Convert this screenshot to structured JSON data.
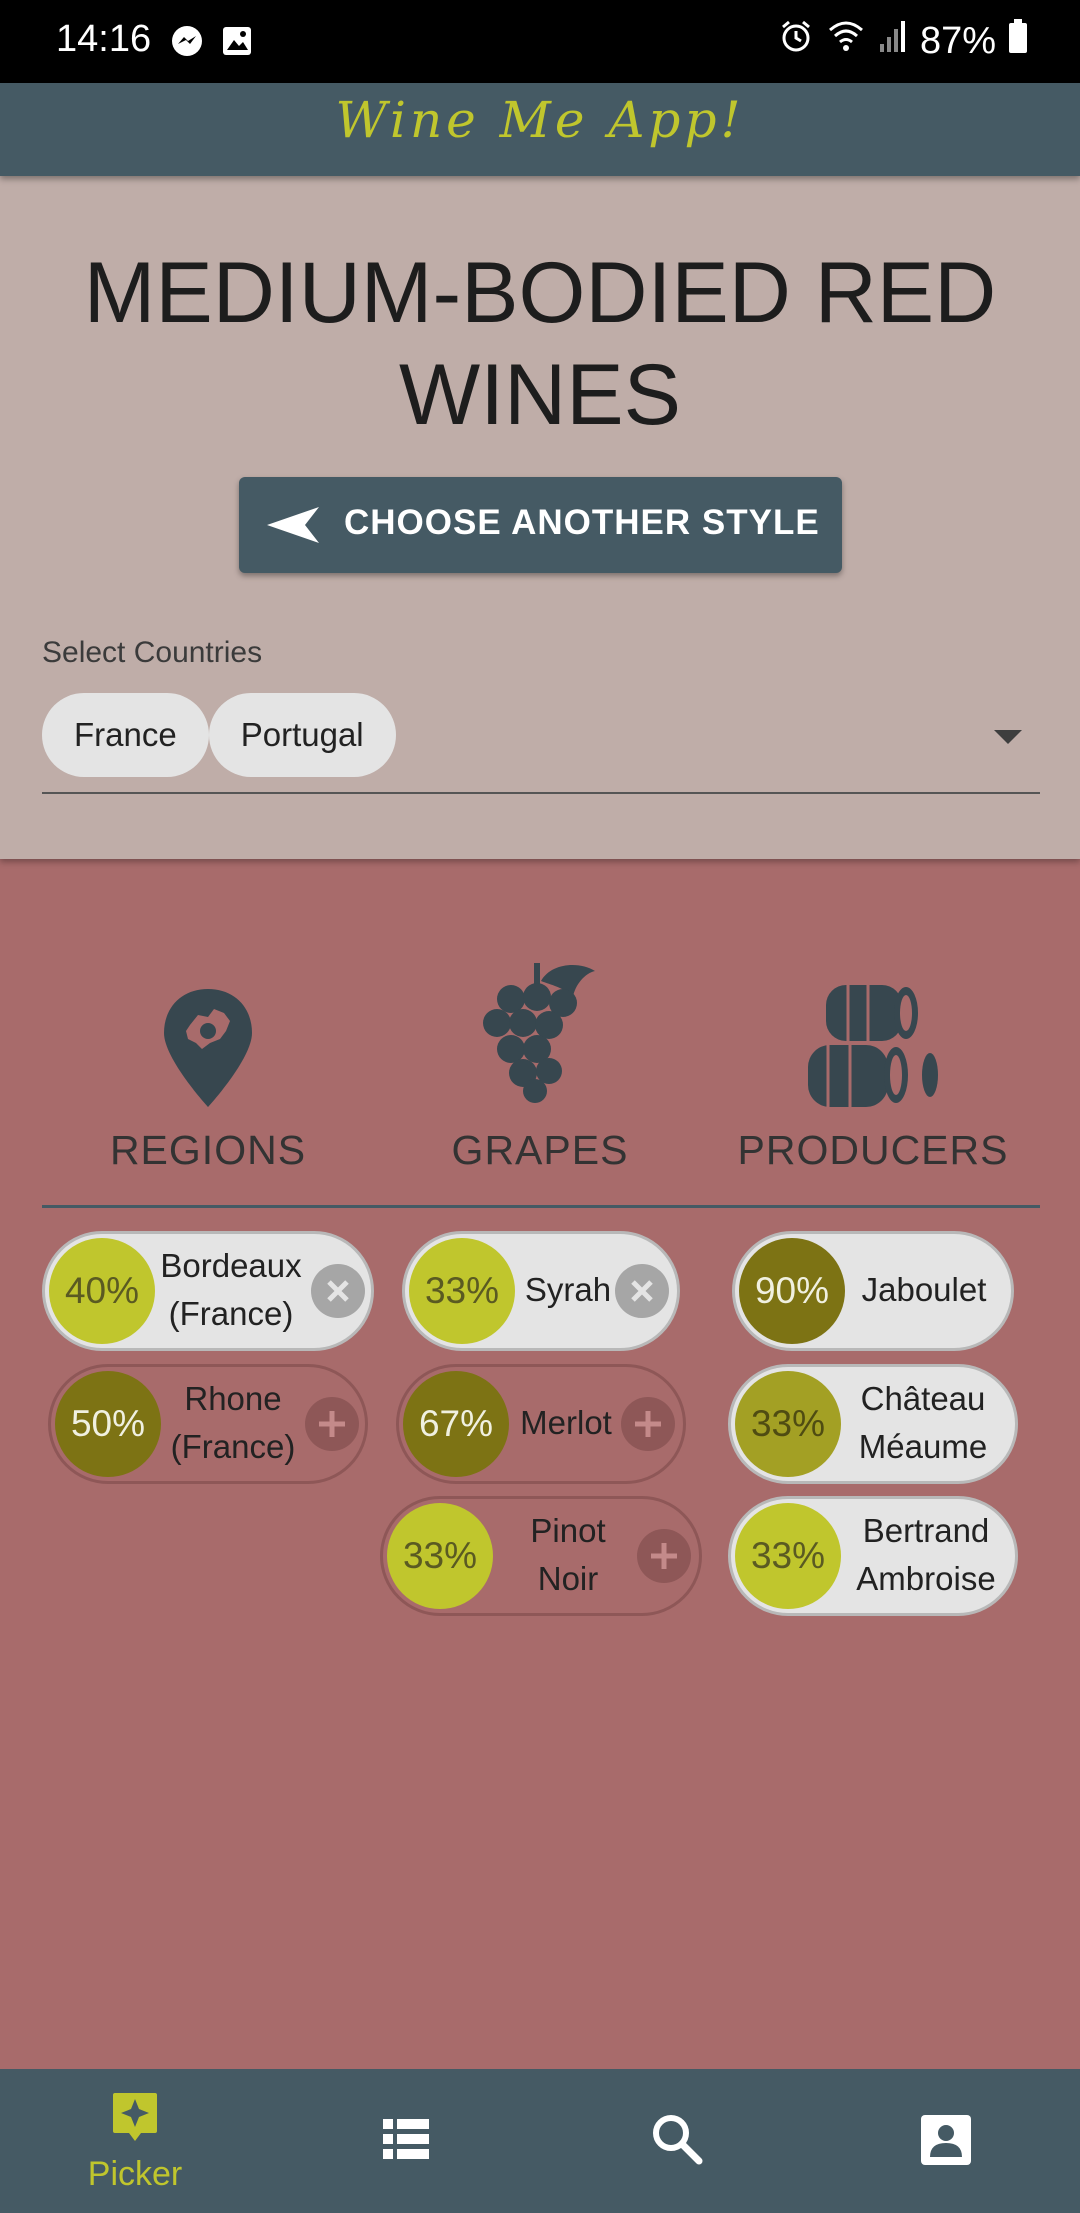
{
  "status_bar": {
    "time": "14:16",
    "battery": "87%"
  },
  "app": {
    "title": "Wine Me App!"
  },
  "header": {
    "style_title": "MEDIUM-BODIED RED WINES",
    "choose_button": "CHOOSE ANOTHER STYLE",
    "select_label": "Select Countries",
    "selected_countries": [
      "France",
      "Portugal"
    ]
  },
  "categories": [
    {
      "label": "REGIONS",
      "icon": "map-pin-europe-icon"
    },
    {
      "label": "GRAPES",
      "icon": "grapes-icon"
    },
    {
      "label": "PRODUCERS",
      "icon": "barrels-icon"
    }
  ],
  "regions": [
    {
      "pct": "40%",
      "line1": "Bordeaux",
      "line2": "(France)",
      "selected": true
    },
    {
      "pct": "50%",
      "line1": "Rhone",
      "line2": "(France)",
      "selected": false
    }
  ],
  "grapes": [
    {
      "pct": "33%",
      "line1": "Syrah",
      "line2": "",
      "selected": true
    },
    {
      "pct": "67%",
      "line1": "Merlot",
      "line2": "",
      "selected": false
    },
    {
      "pct": "33%",
      "line1": "Pinot",
      "line2": "Noir",
      "selected": false
    }
  ],
  "producers": [
    {
      "pct": "90%",
      "line1": "Jaboulet",
      "line2": "",
      "selected": true
    },
    {
      "pct": "33%",
      "line1": "Château",
      "line2": "Méaume",
      "selected": true
    },
    {
      "pct": "33%",
      "line1": "Bertrand",
      "line2": "Ambroise",
      "selected": true
    }
  ],
  "nav": {
    "items": [
      {
        "label": "Picker",
        "icon": "sparkle-picker-icon",
        "active": true
      },
      {
        "label": "",
        "icon": "list-icon",
        "active": false
      },
      {
        "label": "",
        "icon": "search-icon",
        "active": false
      },
      {
        "label": "",
        "icon": "account-icon",
        "active": false
      }
    ]
  },
  "colors": {
    "primary": "#455a64",
    "accent": "#c0c62d",
    "top_bg": "#bfada8",
    "main_bg": "#a86b6b",
    "pct_light": "#c0c62d",
    "pct_mid": "#a3a024",
    "pct_dark": "#7d7314"
  }
}
